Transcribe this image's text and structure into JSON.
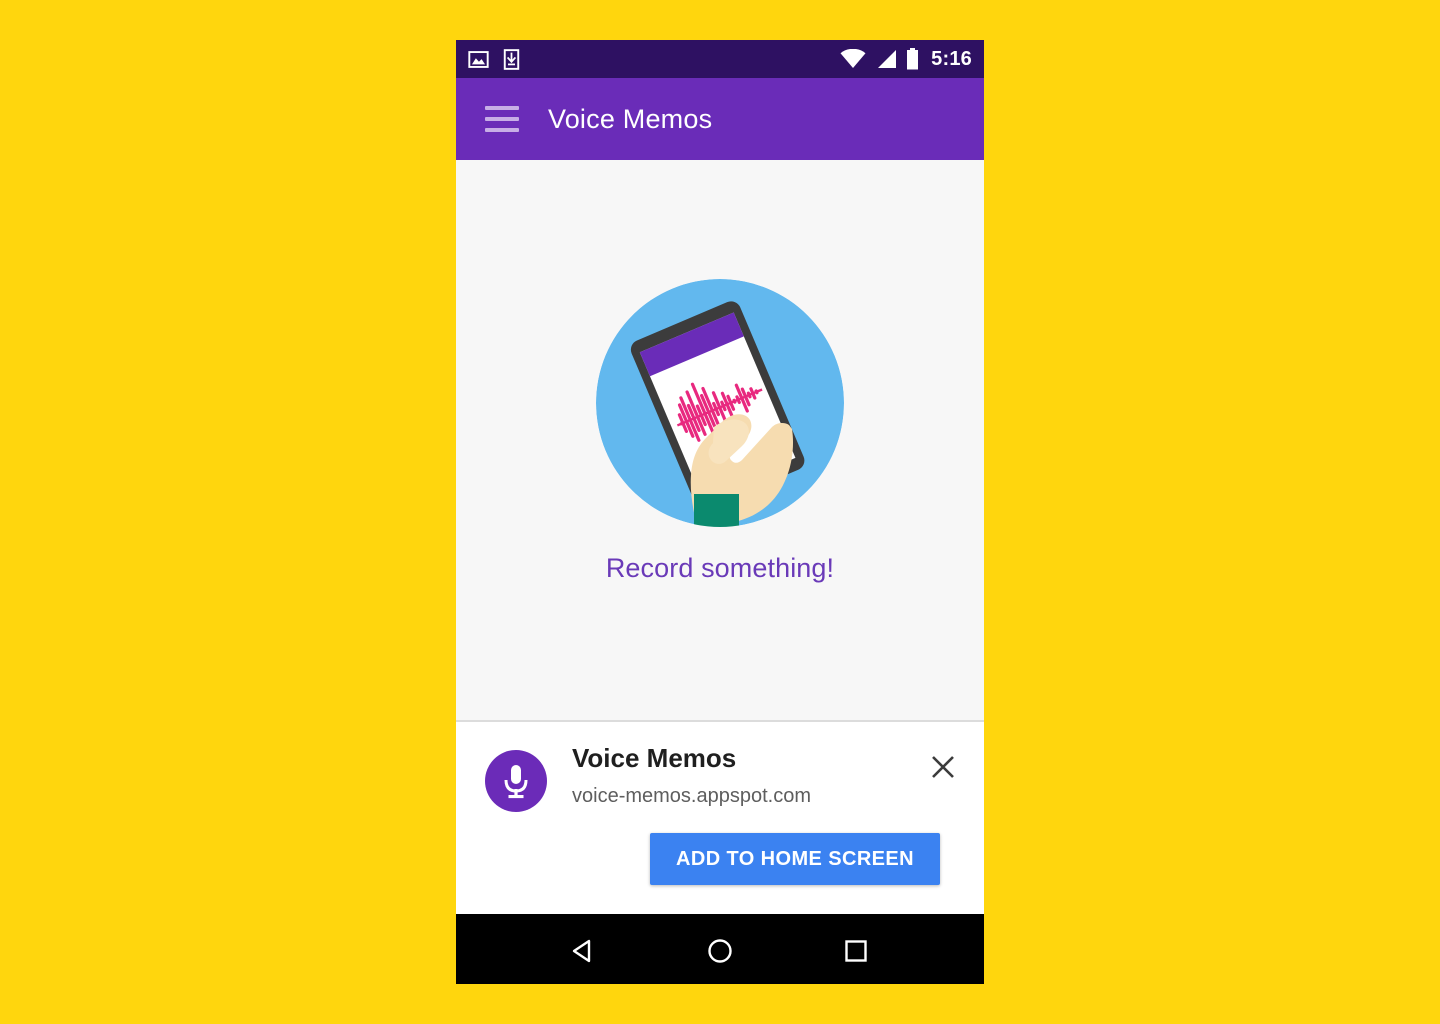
{
  "device": {
    "status_bar": {
      "left_icons": [
        "image-icon",
        "download-icon"
      ],
      "right_icons": [
        "wifi-icon",
        "signal-icon",
        "battery-icon"
      ],
      "time": "5:16",
      "background_color": "#2E1162"
    },
    "nav_bar": {
      "back_label": "Back",
      "home_label": "Home",
      "recents_label": "Recent apps",
      "background_color": "#000000"
    }
  },
  "app_bar": {
    "menu_label": "Menu",
    "title": "Voice Memos",
    "background_color": "#6A2CB8"
  },
  "content": {
    "illustration_name": "hand-holding-phone-waveform-illustration",
    "empty_state_text": "Record something!",
    "empty_state_color": "#6A3AB8",
    "background_color": "#F7F7F7",
    "illustration_colors": {
      "circle": "#62B8EE",
      "phone_body": "#3C3C3C",
      "phone_screen": "#FFFFFF",
      "phone_app_bar": "#6A2CB8",
      "waveform": "#E8297F",
      "skin": "#F6DCB0",
      "sleeve": "#0B8A6E"
    }
  },
  "install_banner": {
    "icon_name": "microphone-icon",
    "icon_background_color": "#6B2BB8",
    "title": "Voice Memos",
    "origin": "voice-memos.appspot.com",
    "close_label": "Close",
    "add_button_label": "ADD TO HOME SCREEN",
    "add_button_color": "#3B82F1"
  },
  "page": {
    "background_color": "#FFD60D"
  }
}
